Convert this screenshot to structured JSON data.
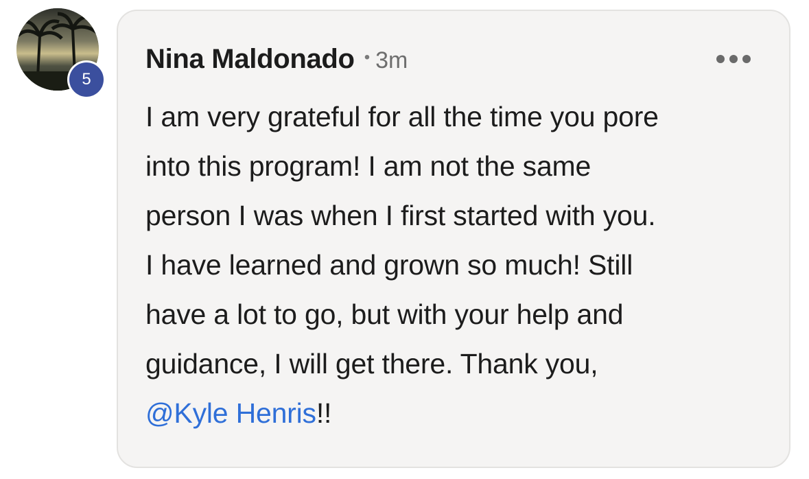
{
  "comment": {
    "author": "Nina Maldonado",
    "separator": "•",
    "timestamp": "3m",
    "avatar_badge": "5",
    "more_icon": "more-horizontal-icon",
    "body_lines": [
      "I am very grateful for all the time you pore",
      "into this program! I am not the same",
      "person I was when I first started with you.",
      "I have learned and grown so much! Still",
      "have a lot to go, but with your help and",
      "guidance, I will get there. Thank you,"
    ],
    "mention": "@Kyle Henris",
    "mention_suffix": "!!"
  },
  "colors": {
    "bubble_background": "#f5f4f3",
    "bubble_border": "#e3e2e0",
    "mention": "#2f6fd8",
    "badge": "#3b4f9e",
    "text": "#1c1c1c",
    "muted": "#6e6e6e"
  }
}
